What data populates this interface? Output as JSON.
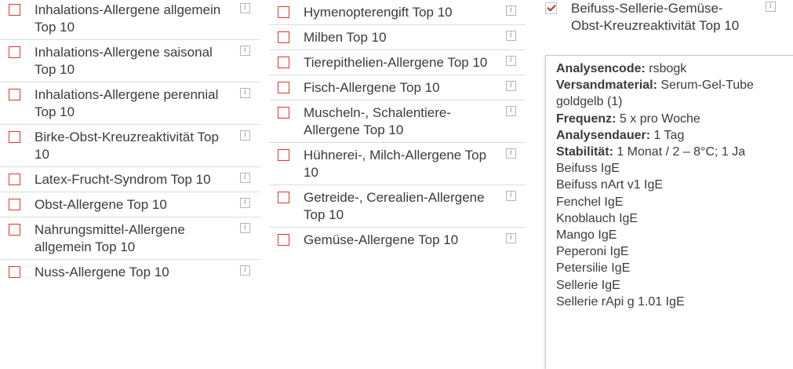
{
  "info_icon_glyph": "i",
  "column1": [
    {
      "label": "Inhalations-Allergene allgemein Top 10",
      "checked": false
    },
    {
      "label": "Inhalations-Allergene saisonal Top 10",
      "checked": false
    },
    {
      "label": "Inhalations-Allergene perennial Top 10",
      "checked": false
    },
    {
      "label": "Birke-Obst-Kreuzreaktivität Top 10",
      "checked": false
    },
    {
      "label": "Latex-Frucht-Syndrom Top 10",
      "checked": false
    },
    {
      "label": "Obst-Allergene Top 10",
      "checked": false
    },
    {
      "label": "Nahrungsmittel-Allergene allgemein Top 10",
      "checked": false
    },
    {
      "label": "Nuss-Allergene Top 10",
      "checked": false
    }
  ],
  "column2": [
    {
      "label": "Hymenopterengift Top 10",
      "checked": false
    },
    {
      "label": "Milben Top 10",
      "checked": false
    },
    {
      "label": "Tierepithelien-Allergene Top 10",
      "checked": false
    },
    {
      "label": "Fisch-Allergene Top 10",
      "checked": false
    },
    {
      "label": "Muscheln-, Schalentiere-Allergene Top 10",
      "checked": false
    },
    {
      "label": "Hühnerei-, Milch-Allergene Top 10",
      "checked": false
    },
    {
      "label": "Getreide-, Cerealien-Allergene Top 10",
      "checked": false
    },
    {
      "label": "Gemüse-Allergene Top 10",
      "checked": false
    }
  ],
  "column3": [
    {
      "label": "Beifuss-Sellerie-Gemüse-Obst-Kreuzreaktivität Top 10",
      "checked": true
    }
  ],
  "tooltip": {
    "analysencode_label": "Analysencode:",
    "analysencode_value": " rsbogk",
    "versandmaterial_label": "Versandmaterial:",
    "versandmaterial_value": " Serum-Gel-Tube",
    "versandmaterial_cont": "goldgelb (1)",
    "frequenz_label": "Frequenz:",
    "frequenz_value": " 5 x pro Woche",
    "analysendauer_label": "Analysendauer:",
    "analysendauer_value": " 1 Tag",
    "stabilitaet_label": "Stabilität:",
    "stabilitaet_value": " 1 Monat / 2 – 8°C; 1 Ja",
    "tests": [
      "Beifuss IgE",
      "Beifuss nArt v1 IgE",
      "Fenchel IgE",
      "Knoblauch IgE",
      "Mango IgE",
      "Peperoni IgE",
      "Petersilie IgE",
      "Sellerie IgE",
      "Sellerie rApi g 1.01 IgE"
    ]
  },
  "colors": {
    "text": "#3b3b3b",
    "checkbox_border": "#e2352b",
    "checkmark": "#c2272d",
    "divider": "#dcdcdc",
    "info_border": "#b5b5b5"
  }
}
